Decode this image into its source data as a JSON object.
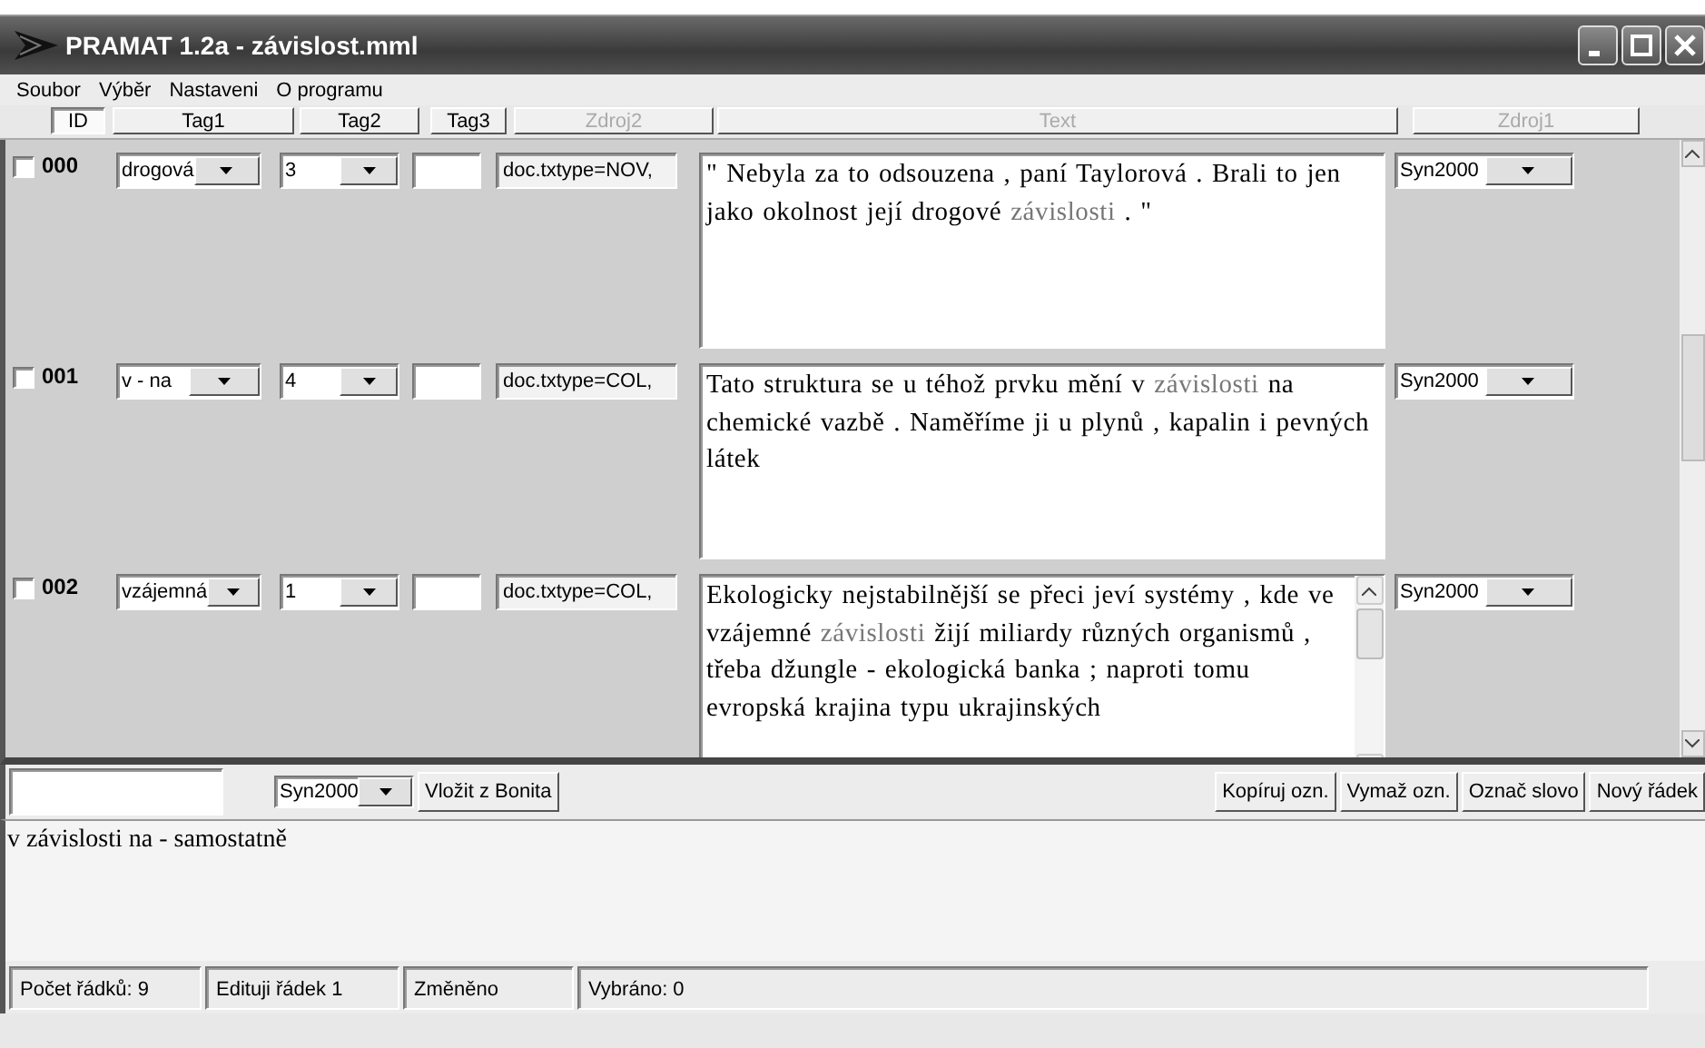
{
  "window": {
    "title": "PRAMAT 1.2a - závislost.mml"
  },
  "menu": [
    "Soubor",
    "Výběr",
    "Nastaveni",
    "O programu"
  ],
  "columns": [
    {
      "label": "ID",
      "disabled": false
    },
    {
      "label": "Tag1",
      "disabled": false
    },
    {
      "label": "Tag2",
      "disabled": false
    },
    {
      "label": "Tag3",
      "disabled": false
    },
    {
      "label": "Zdroj2",
      "disabled": true
    },
    {
      "label": "Text",
      "disabled": true
    },
    {
      "label": "Zdroj1",
      "disabled": true
    }
  ],
  "rows": [
    {
      "id": "000",
      "checked": false,
      "tag1": "drogová",
      "tag2": "3",
      "zdroj2": "doc.txtype=NOV,",
      "zdroj1": "Syn2000",
      "scrollable": false,
      "text": [
        {
          "text": "\" Nebyla za to odsouzena , paní Taylorová . Brali to jen jako okolnost její drogové ",
          "highlight": false
        },
        {
          "text": "závislosti",
          "highlight": true
        },
        {
          "text": " . \"",
          "highlight": false
        }
      ]
    },
    {
      "id": "001",
      "checked": false,
      "tag1": "v - na",
      "tag2": "4",
      "zdroj2": "doc.txtype=COL,",
      "zdroj1": "Syn2000",
      "scrollable": false,
      "text": [
        {
          "text": "Tato struktura se u téhož prvku mění v ",
          "highlight": false
        },
        {
          "text": "závislosti",
          "highlight": true
        },
        {
          "text": " na chemické vazbě . Naměříme ji u plynů , kapalin i pevných látek",
          "highlight": false
        }
      ]
    },
    {
      "id": "002",
      "checked": false,
      "tag1": "vzájemná",
      "tag2": "1",
      "zdroj2": "doc.txtype=COL,",
      "zdroj1": "Syn2000",
      "scrollable": true,
      "text": [
        {
          "text": "Ekologicky nejstabilnější se přeci jeví systémy , kde ve vzájemné ",
          "highlight": false
        },
        {
          "text": "závislosti",
          "highlight": true
        },
        {
          "text": " žijí miliardy různých organismů , třeba džungle - ekologická banka ; naproti tomu evropská krajina typu ukrajinských",
          "highlight": false
        }
      ]
    }
  ],
  "toolbar": {
    "source": "Syn2000",
    "insert_button": "Vložit z Bonita",
    "buttons": [
      "Kopíruj ozn.",
      "Vymaž ozn.",
      "Označ slovo",
      "Nový řádek"
    ]
  },
  "note": "v závislosti na - samostatně",
  "status_bar": [
    "Počet řádků: 9",
    "Edituji řádek 1",
    "Změněno",
    "Vybráno: 0"
  ]
}
